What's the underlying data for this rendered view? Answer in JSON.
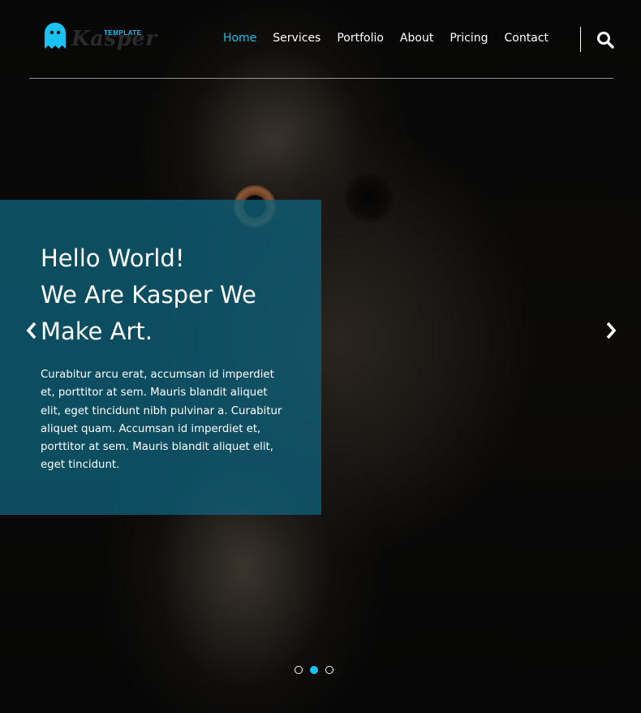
{
  "brand": {
    "name": "Kasper",
    "tag": "TEMPLATE",
    "accent_color": "#19c2f0"
  },
  "nav": {
    "items": [
      {
        "label": "Home",
        "active": true
      },
      {
        "label": "Services",
        "active": false
      },
      {
        "label": "Portfolio",
        "active": false
      },
      {
        "label": "About",
        "active": false
      },
      {
        "label": "Pricing",
        "active": false
      },
      {
        "label": "Contact",
        "active": false
      }
    ],
    "search_icon": "search-icon"
  },
  "hero": {
    "headline_lines": [
      "Hello World!",
      "We Are Kasper We",
      "Make Art."
    ],
    "body": "Curabitur arcu erat, accumsan id imperdiet et, porttitor at sem. Mauris blandit aliquet elit, eget tincidunt nibh pulvinar a. Curabitur aliquet quam. Accumsan id imperdiet et, porttitor at sem. Mauris blandit aliquet elit, eget tincidunt.",
    "box_color": "#0e607a",
    "prev_icon": "chevron-left-icon",
    "next_icon": "chevron-right-icon"
  },
  "slider": {
    "dots": 3,
    "active_dot": 2
  }
}
